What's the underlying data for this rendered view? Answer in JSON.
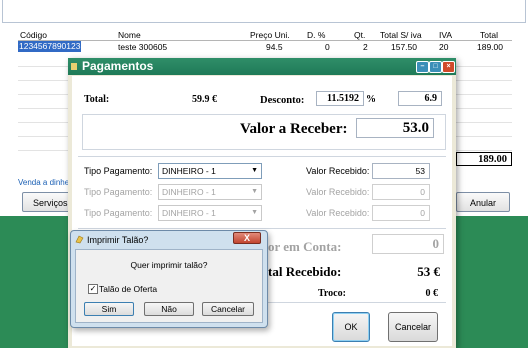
{
  "grid": {
    "headers": [
      "Código",
      "Nome",
      "Preço Uni.",
      "D. %",
      "Qt.",
      "Total S/ iva",
      "IVA",
      "Total"
    ],
    "row": {
      "codigo": "1234567890123",
      "nome": "teste 300605",
      "preco": "94.5",
      "desconto": "0",
      "qt": "2",
      "total_s_iva": "157.50",
      "iva": "20",
      "total": "189.00"
    },
    "grand_total": "189.00"
  },
  "background": {
    "venda_text": "Venda a dinhe",
    "servicos_label": "Serviços",
    "anular_label": "Anular"
  },
  "pagamentos": {
    "title": "Pagamentos",
    "total_label": "Total:",
    "total_value": "59.9 €",
    "desconto_label": "Desconto:",
    "desconto_pct": "11.5192",
    "pct_sign": "%",
    "desconto_value": "6.9",
    "valor_receber_label": "Valor a Receber:",
    "valor_receber_value": "53.0",
    "rows": [
      {
        "tipo_label": "Tipo Pagamento:",
        "tipo_value": "DINHEIRO - 1",
        "recebido_label": "Valor Recebido:",
        "recebido_value": "53"
      },
      {
        "tipo_label": "Tipo Pagamento:",
        "tipo_value": "DINHEIRO - 1",
        "recebido_label": "Valor Recebido:",
        "recebido_value": "0"
      },
      {
        "tipo_label": "Tipo Pagamento:",
        "tipo_value": "DINHEIRO - 1",
        "recebido_label": "Valor Recebido:",
        "recebido_value": "0"
      }
    ],
    "valor_conta_label": "or em Conta:",
    "valor_conta_value": "0",
    "total_recebido_label": "tal Recebido:",
    "total_recebido_value": "53 €",
    "troco_label": "Troco:",
    "troco_value": "0 €",
    "ok_label": "OK",
    "cancelar_label": "Cancelar"
  },
  "imprimir": {
    "title": "Imprimir Talão?",
    "close_glyph": "X",
    "question": "Quer imprimir talão?",
    "checkbox_label": "Talão de Oferta",
    "checkbox_mark": "✓",
    "sim_label": "Sim",
    "nao_label": "Não",
    "cancelar_label": "Cancelar"
  },
  "icons": {
    "close": "×",
    "minimize": "–",
    "maximize": "□",
    "dropdown": "▼"
  },
  "colors": {
    "title_bar": "#1f7a58",
    "selection": "#316ac5",
    "desktop": "#2c8b56"
  }
}
